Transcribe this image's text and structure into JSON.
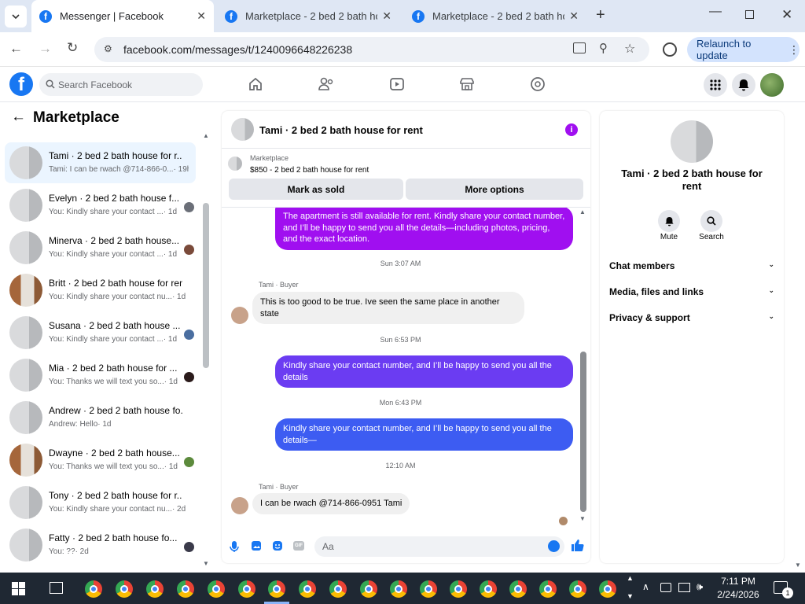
{
  "browser": {
    "tabs": [
      {
        "title": "Messenger | Facebook"
      },
      {
        "title": "Marketplace - 2 bed 2 bath hou"
      },
      {
        "title": "Marketplace - 2 bed 2 bath hou"
      }
    ],
    "url": "facebook.com/messages/t/1240096648226238",
    "relaunch_label": "Relaunch to update"
  },
  "facebook": {
    "search_placeholder": "Search Facebook"
  },
  "sidebar": {
    "title": "Marketplace",
    "conversations": [
      {
        "name": "Tami · 2 bed 2 bath house for r...",
        "preview": "Tami: I can be rwach @714-866-0...",
        "time": "· 19h"
      },
      {
        "name": "Evelyn · 2 bed 2 bath house f...",
        "preview": "You: Kindly share your contact ...",
        "time": "· 1d"
      },
      {
        "name": "Minerva · 2 bed 2 bath house...",
        "preview": "You: Kindly share your contact ...",
        "time": "· 1d"
      },
      {
        "name": "Britt · 2 bed 2 bath house for rent",
        "preview": "You: Kindly share your contact nu...",
        "time": "· 1d"
      },
      {
        "name": "Susana · 2 bed 2 bath house ...",
        "preview": "You: Kindly share your contact ...",
        "time": "· 1d"
      },
      {
        "name": "Mia · 2 bed 2 bath house for ...",
        "preview": "You: Thanks we will text you so...",
        "time": "· 1d"
      },
      {
        "name": "Andrew · 2 bed 2 bath house fo...",
        "preview": "Andrew: Hello",
        "time": "· 1d"
      },
      {
        "name": "Dwayne · 2 bed 2 bath house...",
        "preview": "You: Thanks we will text you so...",
        "time": "· 1d"
      },
      {
        "name": "Tony · 2 bed 2 bath house for r...",
        "preview": "You: Kindly share your contact nu...",
        "time": "· 2d"
      },
      {
        "name": "Fatty · 2 bed 2 bath house fo...",
        "preview": "You: ??",
        "time": "· 2d"
      }
    ]
  },
  "chat": {
    "title": "Tami · 2 bed 2 bath house for rent",
    "listing_source": "Marketplace",
    "listing_title": "$850 - 2 bed 2 bath house for rent",
    "mark_sold_label": "Mark as sold",
    "more_options_label": "More options",
    "messages": [
      {
        "text": "The apartment is still available for rent. Kindly share your contact number, and I’ll be happy to send you all the details—including photos, pricing, and the exact location."
      },
      {
        "stamp": "Sun 3:07 AM"
      },
      {
        "sender": "Tami · Buyer",
        "text": "This is too good to be true. Ive seen the same place in another state"
      },
      {
        "stamp": "Sun 6:53 PM"
      },
      {
        "text": "Kindly share your contact number, and I’ll be happy to send you all the details"
      },
      {
        "stamp": "Mon 6:43 PM"
      },
      {
        "text": "Kindly share your contact number, and I’ll be happy to send you all the details—"
      },
      {
        "stamp": "12:10 AM"
      },
      {
        "sender": "Tami · Buyer",
        "text": "I can be rwach @714-866-0951 Tami"
      }
    ],
    "composer_placeholder": "Aa",
    "composer_gif": "GIF"
  },
  "info_panel": {
    "title": "Tami · 2 bed 2 bath house for rent",
    "mute_label": "Mute",
    "search_label": "Search",
    "sections": [
      "Chat members",
      "Media, files and links",
      "Privacy & support"
    ]
  },
  "taskbar": {
    "time": "7:11 PM",
    "date": "2/24/2026",
    "notification_count": "1"
  },
  "colors": {
    "facebook_blue": "#1877f2",
    "bubble_purple": "#a00ff0",
    "bubble_violet": "#6b3cf2",
    "bubble_blue": "#3d5cf2",
    "info_purple": "#a00ff0"
  }
}
